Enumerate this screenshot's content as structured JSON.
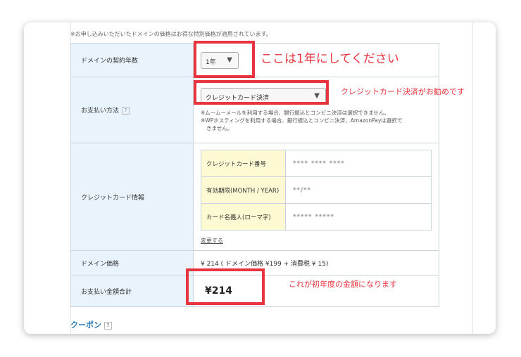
{
  "page_note": "※お申し込みいただいたドメインの価格はお得な特別価格が適用されています。",
  "rows": {
    "contract_years": {
      "label": "ドメインの契約年数",
      "value": "1年"
    },
    "payment_method": {
      "label": "お支払い方法",
      "value": "クレジットカード決済",
      "notes": [
        "※ムームーメールを利用する場合、銀行振込とコンビニ決済は選択できません。",
        "※WPホスティングを利用する場合、銀行振込とコンビニ決済、AmazonPayは選択で",
        "きません。"
      ]
    },
    "credit_card": {
      "label": "クレジットカード情報",
      "fields": [
        {
          "label": "クレジットカード番号",
          "value": "**** **** ****"
        },
        {
          "label": "有効期限(MONTH / YEAR)",
          "value": "**/**"
        },
        {
          "label": "カード名義人(ローマ字)",
          "value": "***** *****"
        }
      ],
      "change_link": "変更する"
    },
    "domain_price": {
      "label": "ドメイン価格",
      "value": "¥ 214 ( ドメイン価格 ¥199 + 消費税 ¥ 15)"
    },
    "total": {
      "label": "お支払い金額合計",
      "value": "¥214"
    }
  },
  "coupon": {
    "title": "クーポン"
  },
  "help_glyph": "?",
  "arrow_glyph": "▼",
  "annotations": {
    "years": "ここは1年にしてください",
    "payment": "クレジットカード決済がお勧めです",
    "total": "これが初年度の金額になります"
  },
  "colors": {
    "highlight": "#e8343f",
    "label_bg": "#e9f3fb",
    "card_label_bg": "#fcf9d3",
    "coupon": "#2a7ab8"
  }
}
